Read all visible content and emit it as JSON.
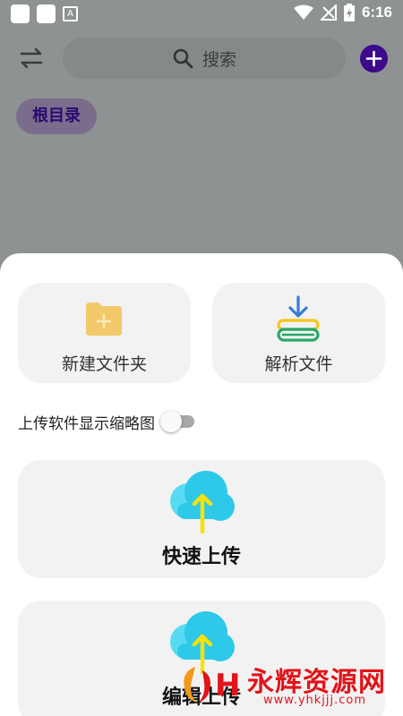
{
  "status_bar": {
    "time": "6:16",
    "left_icons": [
      "notification-square-icon",
      "notification-square-icon",
      "app-a-icon"
    ],
    "right_icons": [
      "wifi-icon",
      "no-signal-icon",
      "battery-charging-icon"
    ]
  },
  "top_bar": {
    "swap_icon": "swap-arrows-icon",
    "search_placeholder": "搜索",
    "add_icon": "plus-circle-icon"
  },
  "breadcrumb": {
    "root_label": "根目录"
  },
  "sheet": {
    "new_folder_label": "新建文件夹",
    "parse_file_label": "解析文件",
    "toggle_label": "上传软件显示缩略图",
    "toggle_on": false,
    "quick_upload_label": "快速上传",
    "edit_upload_label": "编辑上传"
  },
  "watermark": {
    "text": "永辉资源网",
    "url": "www.yhkjjj.com"
  },
  "colors": {
    "accent": "#3d0a8c",
    "folder": "#f2c96a",
    "cloud": "#2ec9e8",
    "arrow": "#f5e20a",
    "watermark": "#e0141a"
  }
}
